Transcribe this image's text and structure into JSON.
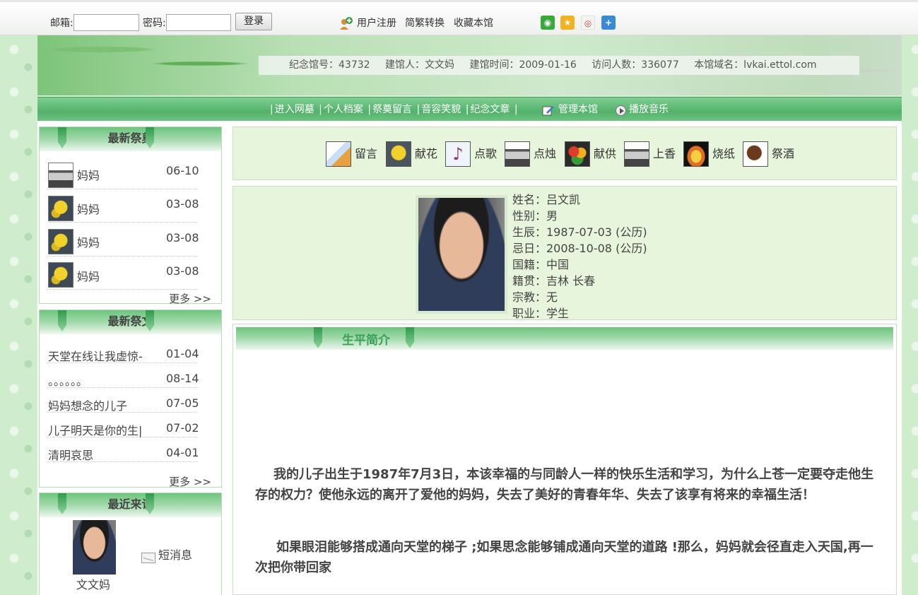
{
  "topbar": {
    "email_label": "邮箱:",
    "password_label": "密码:",
    "login_button": "登录",
    "register_link": "用户注册",
    "convert_link": "简繁转换",
    "bookmark_link": "收藏本馆",
    "share_icons": [
      "wechat-icon",
      "qzone-icon",
      "weibo-icon",
      "more-share-icon"
    ]
  },
  "banner": {
    "memorial_no": "纪念馆号：43732",
    "founder": "建馆人：文文妈",
    "created": "建馆时间：2009-01-16",
    "visits": "访问人数：336077",
    "domain": "本馆域名：lvkai.ettol.com"
  },
  "nav": {
    "items": [
      "进入网墓",
      "个人档案",
      "祭奠留言",
      "音容笑貌",
      "纪念文章"
    ],
    "manage": "管理本馆",
    "music": "播放音乐"
  },
  "latest_offerings": {
    "title": "最新祭奠",
    "items": [
      {
        "icon": "incense",
        "name": "妈妈",
        "date": "06-10"
      },
      {
        "icon": "flower",
        "name": "妈妈",
        "date": "03-08"
      },
      {
        "icon": "flower",
        "name": "妈妈",
        "date": "03-08"
      },
      {
        "icon": "flower",
        "name": "妈妈",
        "date": "03-08"
      }
    ],
    "more": "更多 >>"
  },
  "latest_articles": {
    "title": "最新祭文",
    "items": [
      {
        "title": "天堂在线让我虚惊-",
        "date": "01-04"
      },
      {
        "title": "。。。。。。",
        "date": "08-14"
      },
      {
        "title": "妈妈想念的儿子",
        "date": "07-05"
      },
      {
        "title": "儿子明天是你的生|",
        "date": "07-02"
      },
      {
        "title": "清明哀思",
        "date": "04-01"
      }
    ],
    "more": "更多 >>"
  },
  "recent_visitors": {
    "title": "最近来访",
    "visitor_name": "文文妈",
    "message_link": "短消息"
  },
  "offerings_bar": [
    {
      "icon": "book-icon",
      "label": "留言"
    },
    {
      "icon": "flower-icon",
      "label": "献花"
    },
    {
      "icon": "music-note-icon",
      "label": "点歌"
    },
    {
      "icon": "candle-icon",
      "label": "点烛"
    },
    {
      "icon": "fruit-icon",
      "label": "献供"
    },
    {
      "icon": "incense-icon",
      "label": "上香"
    },
    {
      "icon": "fire-icon",
      "label": "烧纸"
    },
    {
      "icon": "wine-cup-icon",
      "label": "祭酒"
    }
  ],
  "profile": {
    "name": "姓名：吕文凯",
    "gender": "性别：男",
    "birth": "生辰：1987-07-03 (公历)",
    "death": "忌日：2008-10-08 (公历)",
    "nationality": "国籍：中国",
    "hometown": "籍贯：吉林 长春",
    "religion": "宗教：无",
    "occupation": "职业：学生"
  },
  "bio": {
    "title": "生平简介",
    "p1": "我的儿子出生于1987年7月3日，本该幸福的与同龄人一样的快乐生活和学习，为什么上苍一定要夺走他生存的权力？使他永远的离开了爱他的妈妈，失去了美好的青春年华、失去了该享有将来的幸福生活！",
    "p2": "如果眼泪能够搭成通向天堂的梯子 ;如果思念能够铺成通向天堂的道路 !那么，妈妈就会径直走入天国,再一次把你带回家"
  },
  "colors": {
    "accent_green": "#52b26a",
    "panel_bg": "#e7f5dc",
    "bio_title": "#3aa05a"
  }
}
